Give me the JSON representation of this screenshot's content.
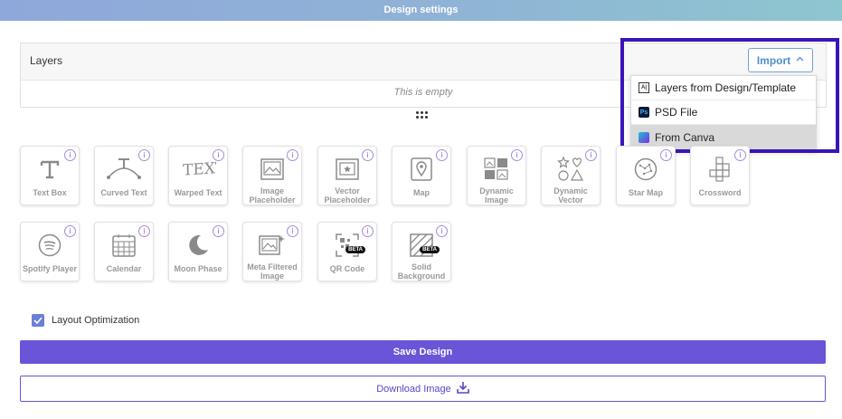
{
  "header": {
    "title": "Design settings"
  },
  "layers": {
    "title": "Layers",
    "empty_text": "This is empty",
    "import_label": "Import"
  },
  "import_menu": [
    {
      "label": "Layers from Design/Template",
      "icon": "design-template-icon"
    },
    {
      "label": "PSD File",
      "icon": "photoshop-icon"
    },
    {
      "label": "From Canva",
      "icon": "canva-icon"
    }
  ],
  "tools_row1": [
    {
      "label": "Text Box",
      "icon": "text-box-icon"
    },
    {
      "label": "Curved Text",
      "icon": "curved-text-icon"
    },
    {
      "label": "Warped Text",
      "icon": "warped-text-icon"
    },
    {
      "label": "Image Placeholder",
      "icon": "image-placeholder-icon"
    },
    {
      "label": "Vector Placeholder",
      "icon": "vector-placeholder-icon"
    },
    {
      "label": "Map",
      "icon": "map-pin-icon"
    },
    {
      "label": "Dynamic Image",
      "icon": "dynamic-image-icon"
    },
    {
      "label": "Dynamic Vector",
      "icon": "dynamic-vector-icon"
    },
    {
      "label": "Star Map",
      "icon": "star-map-icon"
    },
    {
      "label": "Crossword",
      "icon": "crossword-icon"
    }
  ],
  "tools_row2": [
    {
      "label": "Spotify Player",
      "icon": "spotify-icon"
    },
    {
      "label": "Calendar",
      "icon": "calendar-icon"
    },
    {
      "label": "Moon Phase",
      "icon": "moon-icon"
    },
    {
      "label": "Meta Filtered Image",
      "icon": "meta-filtered-image-icon"
    },
    {
      "label": "QR Code",
      "icon": "qr-code-icon",
      "badge": "BETA"
    },
    {
      "label": "Solid Background",
      "icon": "solid-background-icon",
      "badge": "BETA"
    }
  ],
  "options": {
    "layout_optimization_label": "Layout Optimization",
    "layout_optimization_checked": true
  },
  "actions": {
    "save_label": "Save Design",
    "download_label": "Download Image"
  },
  "colors": {
    "accent": "#6a55d8",
    "highlight_border": "#3a14b8",
    "info_icon": "#a78bdb"
  }
}
